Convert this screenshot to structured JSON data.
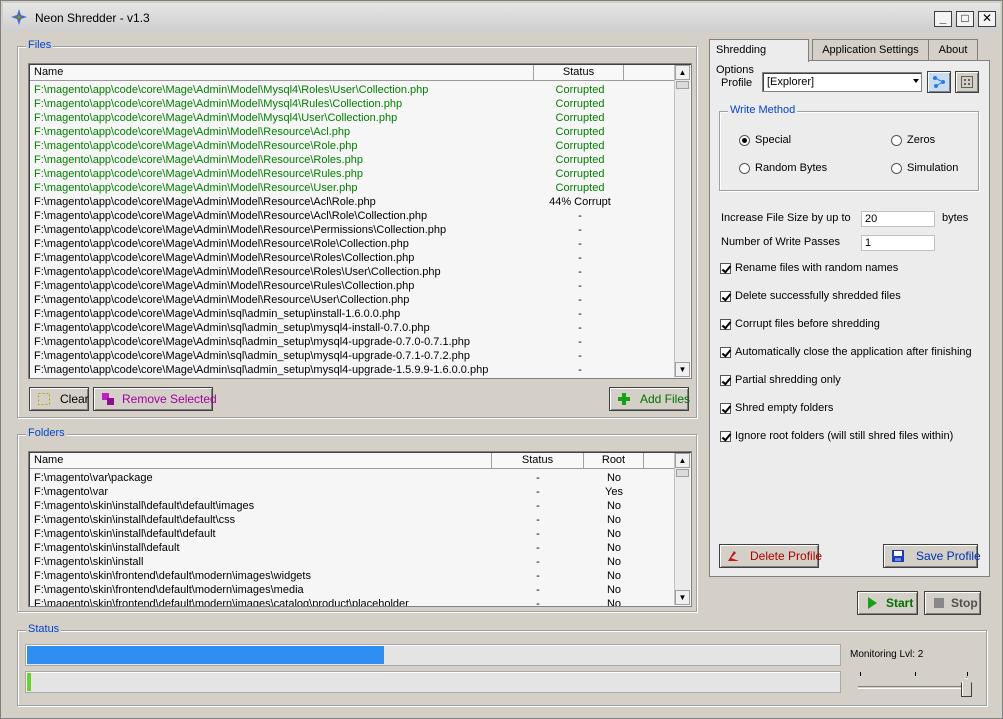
{
  "window": {
    "title": "Neon Shredder - v1.3",
    "controls": [
      "_",
      "□",
      "✕"
    ]
  },
  "files": {
    "group_label": "Files",
    "columns": {
      "name": "Name",
      "status": "Status"
    },
    "rows": [
      {
        "name": "F:\\magento\\app\\code\\core\\Mage\\Admin\\Model\\Mysql4\\Roles\\User\\Collection.php",
        "status": "Corrupted"
      },
      {
        "name": "F:\\magento\\app\\code\\core\\Mage\\Admin\\Model\\Mysql4\\Rules\\Collection.php",
        "status": "Corrupted"
      },
      {
        "name": "F:\\magento\\app\\code\\core\\Mage\\Admin\\Model\\Mysql4\\User\\Collection.php",
        "status": "Corrupted"
      },
      {
        "name": "F:\\magento\\app\\code\\core\\Mage\\Admin\\Model\\Resource\\Acl.php",
        "status": "Corrupted"
      },
      {
        "name": "F:\\magento\\app\\code\\core\\Mage\\Admin\\Model\\Resource\\Role.php",
        "status": "Corrupted"
      },
      {
        "name": "F:\\magento\\app\\code\\core\\Mage\\Admin\\Model\\Resource\\Roles.php",
        "status": "Corrupted"
      },
      {
        "name": "F:\\magento\\app\\code\\core\\Mage\\Admin\\Model\\Resource\\Rules.php",
        "status": "Corrupted"
      },
      {
        "name": "F:\\magento\\app\\code\\core\\Mage\\Admin\\Model\\Resource\\User.php",
        "status": "Corrupted"
      },
      {
        "name": "F:\\magento\\app\\code\\core\\Mage\\Admin\\Model\\Resource\\Acl\\Role.php",
        "status": "44% Corrupt"
      },
      {
        "name": "F:\\magento\\app\\code\\core\\Mage\\Admin\\Model\\Resource\\Acl\\Role\\Collection.php",
        "status": "-"
      },
      {
        "name": "F:\\magento\\app\\code\\core\\Mage\\Admin\\Model\\Resource\\Permissions\\Collection.php",
        "status": "-"
      },
      {
        "name": "F:\\magento\\app\\code\\core\\Mage\\Admin\\Model\\Resource\\Role\\Collection.php",
        "status": "-"
      },
      {
        "name": "F:\\magento\\app\\code\\core\\Mage\\Admin\\Model\\Resource\\Roles\\Collection.php",
        "status": "-"
      },
      {
        "name": "F:\\magento\\app\\code\\core\\Mage\\Admin\\Model\\Resource\\Roles\\User\\Collection.php",
        "status": "-"
      },
      {
        "name": "F:\\magento\\app\\code\\core\\Mage\\Admin\\Model\\Resource\\Rules\\Collection.php",
        "status": "-"
      },
      {
        "name": "F:\\magento\\app\\code\\core\\Mage\\Admin\\Model\\Resource\\User\\Collection.php",
        "status": "-"
      },
      {
        "name": "F:\\magento\\app\\code\\core\\Mage\\Admin\\sql\\admin_setup\\install-1.6.0.0.php",
        "status": "-"
      },
      {
        "name": "F:\\magento\\app\\code\\core\\Mage\\Admin\\sql\\admin_setup\\mysql4-install-0.7.0.php",
        "status": "-"
      },
      {
        "name": "F:\\magento\\app\\code\\core\\Mage\\Admin\\sql\\admin_setup\\mysql4-upgrade-0.7.0-0.7.1.php",
        "status": "-"
      },
      {
        "name": "F:\\magento\\app\\code\\core\\Mage\\Admin\\sql\\admin_setup\\mysql4-upgrade-0.7.1-0.7.2.php",
        "status": "-"
      },
      {
        "name": "F:\\magento\\app\\code\\core\\Mage\\Admin\\sql\\admin_setup\\mysql4-upgrade-1.5.9.9-1.6.0.0.php",
        "status": "-"
      }
    ],
    "clear_label": "Clear",
    "remove_selected_label": "Remove Selected",
    "add_files_label": "Add Files"
  },
  "folders": {
    "group_label": "Folders",
    "columns": {
      "name": "Name",
      "status": "Status",
      "root": "Root"
    },
    "rows": [
      {
        "name": "F:\\magento\\var\\package",
        "status": "-",
        "root": "No"
      },
      {
        "name": "F:\\magento\\var",
        "status": "-",
        "root": "Yes"
      },
      {
        "name": "F:\\magento\\skin\\install\\default\\default\\images",
        "status": "-",
        "root": "No"
      },
      {
        "name": "F:\\magento\\skin\\install\\default\\default\\css",
        "status": "-",
        "root": "No"
      },
      {
        "name": "F:\\magento\\skin\\install\\default\\default",
        "status": "-",
        "root": "No"
      },
      {
        "name": "F:\\magento\\skin\\install\\default",
        "status": "-",
        "root": "No"
      },
      {
        "name": "F:\\magento\\skin\\install",
        "status": "-",
        "root": "No"
      },
      {
        "name": "F:\\magento\\skin\\frontend\\default\\modern\\images\\widgets",
        "status": "-",
        "root": "No"
      },
      {
        "name": "F:\\magento\\skin\\frontend\\default\\modern\\images\\media",
        "status": "-",
        "root": "No"
      },
      {
        "name": "F:\\magento\\skin\\frontend\\default\\modern\\images\\catalog\\product\\placeholder",
        "status": "-",
        "root": "No"
      }
    ]
  },
  "tabs": [
    {
      "label": "Shredding Options",
      "active": true
    },
    {
      "label": "Application Settings",
      "active": false
    },
    {
      "label": "About",
      "active": false
    }
  ],
  "options": {
    "profile_label": "Profile",
    "profile_value": "[Explorer]",
    "write_method_label": "Write Method",
    "methods": {
      "special": "Special",
      "zeros": "Zeros",
      "random_bytes": "Random Bytes",
      "simulation": "Simulation"
    },
    "selected_method": "Special",
    "increase_size_label": "Increase File Size by up to",
    "increase_size_value": "20",
    "increase_size_unit": "bytes",
    "passes_label": "Number of Write Passes",
    "passes_value": "1",
    "checkboxes": [
      {
        "label": "Rename files with random names",
        "checked": true
      },
      {
        "label": "Delete successfully shredded files",
        "checked": true
      },
      {
        "label": "Corrupt files before shredding",
        "checked": true
      },
      {
        "label": "Automatically close the application after finishing",
        "checked": true
      },
      {
        "label": "Partial shredding only",
        "checked": true
      },
      {
        "label": "Shred empty folders",
        "checked": true
      },
      {
        "label": "Ignore root folders (will still shred files within)",
        "checked": true
      }
    ],
    "delete_profile_label": "Delete Profile",
    "save_profile_label": "Save Profile"
  },
  "actions": {
    "start_label": "Start",
    "stop_label": "Stop"
  },
  "status": {
    "group_label": "Status",
    "overall_progress": 0.44,
    "file_progress": 0.005,
    "monitoring_label": "Monitoring Lvl: 2",
    "monitoring_level": 2,
    "colors": {
      "progress": "#2e8ef2",
      "file_progress": "#6ad12a",
      "accent_blue": "#0044cc",
      "corrupted": "#008000"
    }
  }
}
